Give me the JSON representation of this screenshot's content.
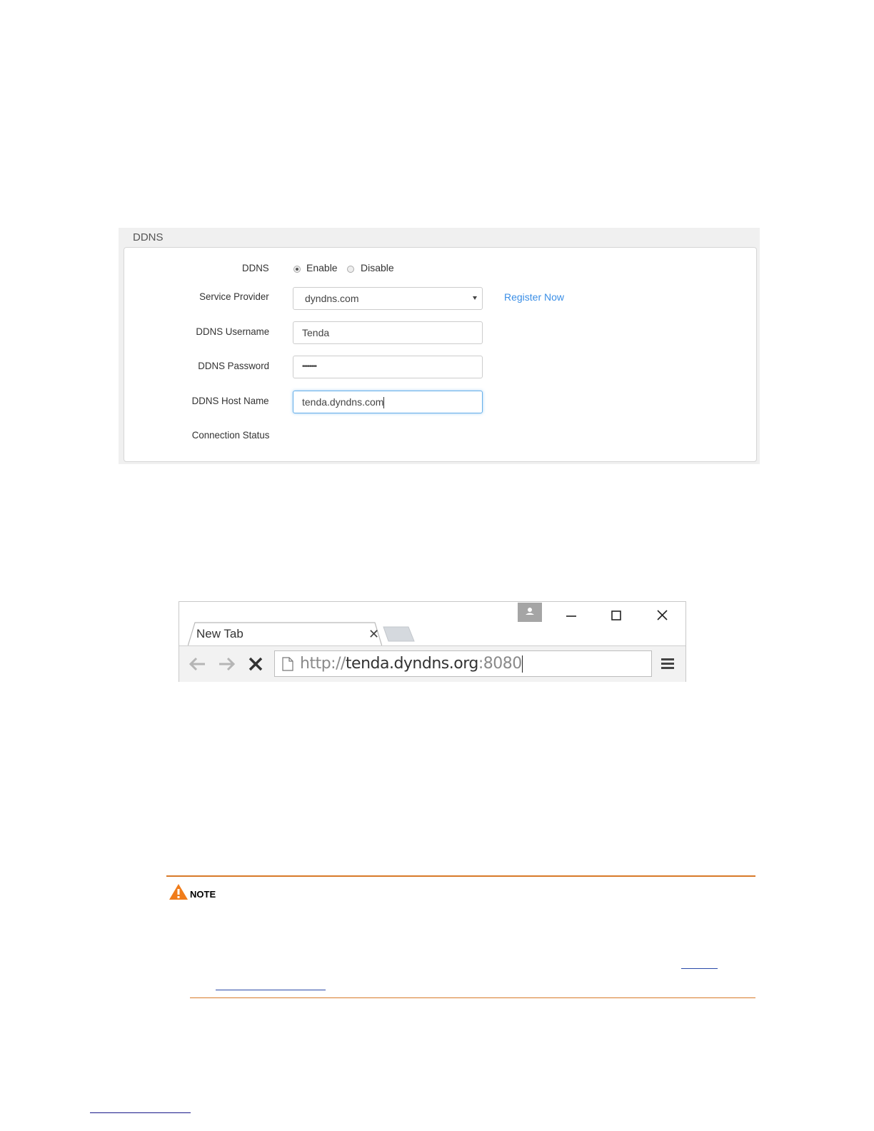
{
  "ddns_panel": {
    "title": "DDNS",
    "ddns_label": "DDNS",
    "enable_label": "Enable",
    "disable_label": "Disable",
    "ddns_selected": "Enable",
    "service_provider_label": "Service Provider",
    "service_provider_value": "dyndns.com",
    "register_now": "Register Now",
    "username_label": "DDNS Username",
    "username_value": "Tenda",
    "password_label": "DDNS Password",
    "password_value": "••••••••",
    "hostname_label": "DDNS Host Name",
    "hostname_value": "tenda.dyndns.com",
    "connection_status_label": "Connection Status",
    "accent_color": "#3a8ee6"
  },
  "browser": {
    "tab_title": "New Tab",
    "url_scheme": "http://",
    "url_host": "tenda.dyndns.org",
    "url_port": ":8080"
  },
  "note": {
    "label": "NOTE",
    "accent_color": "#d87a2a"
  }
}
